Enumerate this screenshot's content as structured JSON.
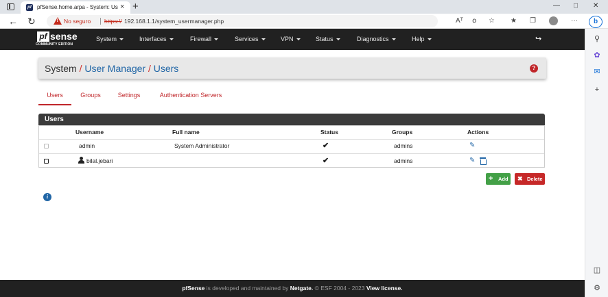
{
  "browser": {
    "tab_title": "pfSense.home.arpa - System: Usé",
    "tab_close": "×",
    "new_tab": "+",
    "security_label": "No seguro",
    "url_scheme": "https://",
    "url_rest": "192.168.1.1/system_usermanager.php",
    "read_aloud": "Aᵀ",
    "translate": "໐",
    "favorites": "☆",
    "more": "⋯",
    "bing": "b",
    "minimize": "—",
    "maximize": "□",
    "close": "✕"
  },
  "navbar": {
    "logo_pf": "pf",
    "logo_sense": "sense",
    "logo_edition": "COMMUNITY EDITION",
    "menus": [
      "System",
      "Interfaces",
      "Firewall",
      "Services",
      "VPN",
      "Status",
      "Diagnostics",
      "Help"
    ],
    "logout": "↪"
  },
  "breadcrumb": {
    "system": "System",
    "user_manager": "User Manager",
    "users": "Users",
    "sep": " / ",
    "help": "?"
  },
  "tabs": [
    "Users",
    "Groups",
    "Settings",
    "Authentication Servers"
  ],
  "panel": {
    "title": "Users",
    "columns": [
      "Username",
      "Full name",
      "Status",
      "Groups",
      "Actions"
    ],
    "rows": [
      {
        "username": "admin",
        "fullname": "System Administrator",
        "status": "✔",
        "groups": "admins",
        "edit": "✎"
      },
      {
        "username": "bilal.jebari",
        "fullname": "",
        "status": "✔",
        "groups": "admins",
        "edit": "✎"
      }
    ]
  },
  "buttons": {
    "add_label": "Add",
    "add_icon": "+",
    "delete_label": "Delete",
    "delete_icon": "✖"
  },
  "info_icon": "i",
  "footer": {
    "brand": "pfSense",
    "text1": " is developed and maintained by ",
    "netgate": "Netgate.",
    "text2": " © ESF 2004 - 2023 ",
    "license": "View license."
  },
  "colors": {
    "nav_bg": "#212121",
    "accent_red": "#c0262a",
    "link_blue": "#2166a6",
    "add_green": "#43a047",
    "delete_red": "#c62828"
  }
}
